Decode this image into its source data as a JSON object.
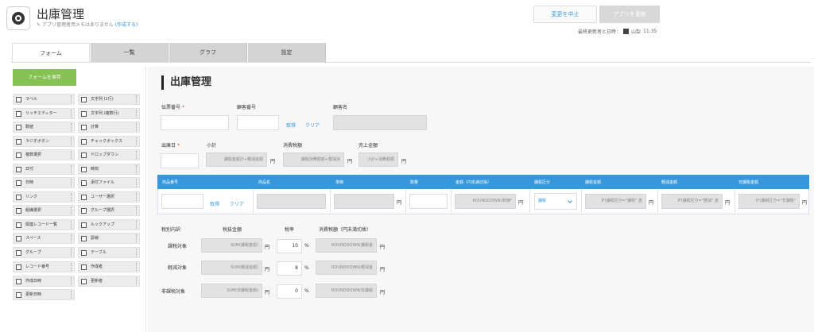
{
  "app": {
    "title": "出庫管理",
    "memo": "アプリ管理者用メモはありません",
    "memo_link": "(作成する)"
  },
  "header": {
    "cancel_label": "変更を中止",
    "update_label": "アプリを更新",
    "last_modified_label": "最終更新者と日時：",
    "last_modified_user": "山梨",
    "last_modified_time": "11:35"
  },
  "tabs": [
    {
      "label": "フォーム"
    },
    {
      "label": "一覧"
    },
    {
      "label": "グラフ"
    },
    {
      "label": "設定"
    }
  ],
  "sidebar": {
    "save_label": "フォームを保存",
    "fields": [
      {
        "label": "ラベル",
        "icon": "tag-icon"
      },
      {
        "label": "文字列 (1行)",
        "icon": "text-line-icon"
      },
      {
        "label": "リッチエディター",
        "icon": "rich-editor-icon"
      },
      {
        "label": "文字列 (複数行)",
        "icon": "text-multiline-icon"
      },
      {
        "label": "数値",
        "icon": "number-icon"
      },
      {
        "label": "計算",
        "icon": "calculator-icon"
      },
      {
        "label": "ラジオボタン",
        "icon": "radio-icon"
      },
      {
        "label": "チェックボックス",
        "icon": "checkbox-icon"
      },
      {
        "label": "複数選択",
        "icon": "multi-select-icon"
      },
      {
        "label": "ドロップダウン",
        "icon": "dropdown-icon"
      },
      {
        "label": "日付",
        "icon": "calendar-icon"
      },
      {
        "label": "時刻",
        "icon": "clock-icon"
      },
      {
        "label": "日時",
        "icon": "datetime-icon"
      },
      {
        "label": "添付ファイル",
        "icon": "attachment-icon"
      },
      {
        "label": "リンク",
        "icon": "link-icon"
      },
      {
        "label": "ユーザー選択",
        "icon": "user-icon"
      },
      {
        "label": "組織選択",
        "icon": "org-icon"
      },
      {
        "label": "グループ選択",
        "icon": "group-icon"
      },
      {
        "label": "関連レコード一覧",
        "icon": "related-records-icon"
      },
      {
        "label": "ルックアップ",
        "icon": "lookup-icon"
      },
      {
        "label": "スペース",
        "icon": "space-icon"
      },
      {
        "label": "罫線",
        "icon": "border-icon"
      },
      {
        "label": "グループ",
        "icon": "group-field-icon"
      },
      {
        "label": "テーブル",
        "icon": "table-icon"
      }
    ],
    "system_fields": [
      {
        "label": "レコード番号",
        "icon": "record-number-icon"
      },
      {
        "label": "作成者",
        "icon": "creator-icon"
      },
      {
        "label": "作成日時",
        "icon": "created-datetime-icon"
      },
      {
        "label": "更新者",
        "icon": "modifier-icon"
      },
      {
        "label": "更新日時",
        "icon": "updated-datetime-icon"
      }
    ]
  },
  "form": {
    "title": "出庫管理",
    "slip_no_label": "伝票番号",
    "customer_no_label": "顧客番号",
    "customer_name_label": "顧客名",
    "get_label": "取得",
    "clear_label": "クリア",
    "ship_date_label": "出庫日",
    "subtotal_label": "小計",
    "tax_label": "消費税額",
    "sales_label": "売上金額",
    "subtotal_formula": "課税金額計+軽減金額",
    "tax_formula": "課税消費税額+軽減消",
    "sales_formula": "小計+消費税額",
    "yen": "円",
    "table": {
      "headers": [
        "商品番号",
        "商品名",
        "単価",
        "数量",
        "金額（円未満切捨）",
        "課税区分",
        "課税金額",
        "軽減金額",
        "非課税金額"
      ],
      "amount_formula": "ROUNDDOWN(単価*",
      "tax_class": "課税",
      "taxable_formula": "IF(課税区分=\"課税\",金",
      "reduced_formula": "IF(課税区分=\"軽減\",金",
      "nontax_formula": "IF(課税区分=\"非課税\""
    },
    "breakdown": {
      "header_label": "税別内訳",
      "pretax_label": "税抜金額",
      "rate_label": "税率",
      "tax_label": "消費税額（円未満切捨）",
      "percent": "%",
      "rows": [
        {
          "label": "課税対象",
          "pretax": "SUM(課税金額)",
          "rate": "10",
          "tax": "ROUNDDOWN(課税金"
        },
        {
          "label": "軽減対象",
          "pretax": "SUM(軽減金額)",
          "rate": "8",
          "tax": "ROUNDDOWN(軽減金"
        },
        {
          "label": "非課税対象",
          "pretax": "SUM(非課税金額)",
          "rate": "0",
          "tax": "ROUNDDOWN(非課税"
        }
      ]
    }
  }
}
